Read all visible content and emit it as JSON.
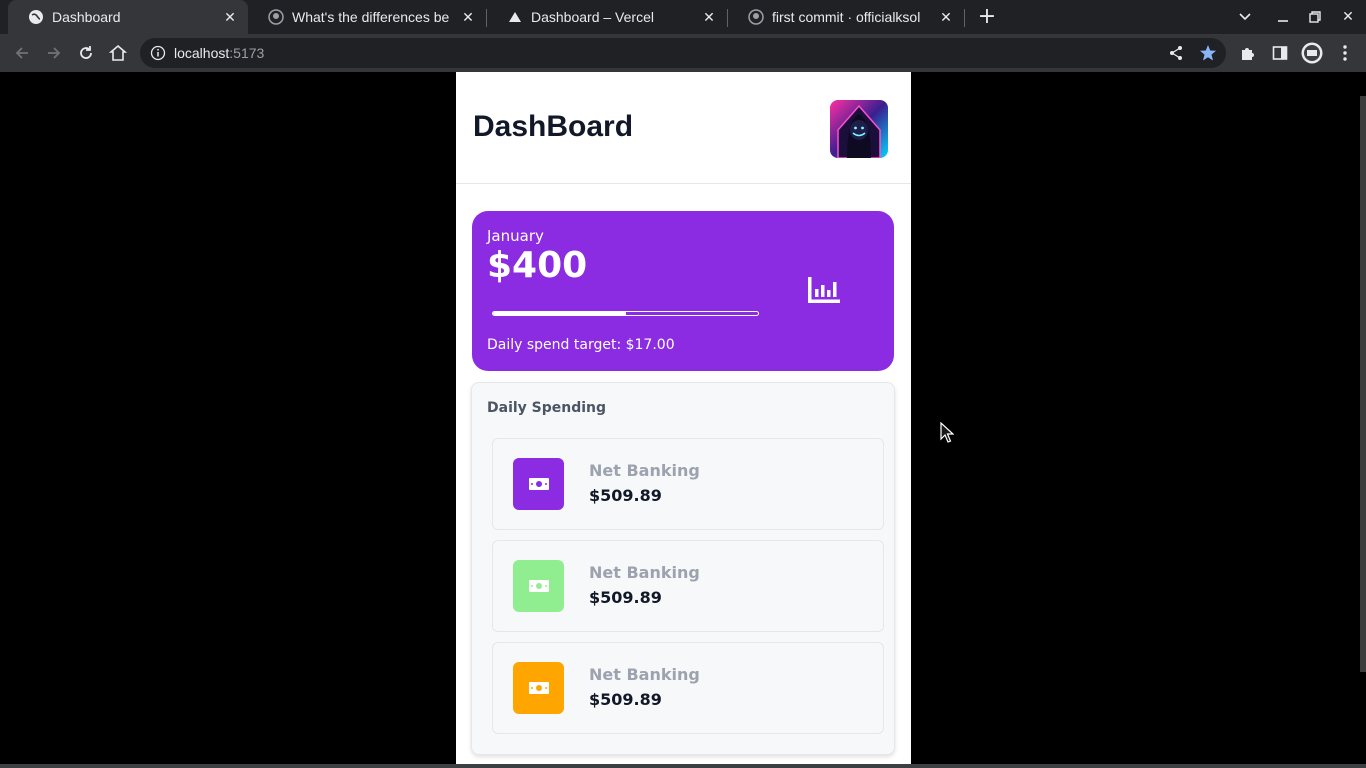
{
  "browser": {
    "tabs": [
      {
        "title": "Dashboard",
        "favicon": "globe-icon",
        "active": true
      },
      {
        "title": "What's the differences be",
        "favicon": "github-icon",
        "active": false
      },
      {
        "title": "Dashboard – Vercel",
        "favicon": "vercel-triangle-icon",
        "active": false
      },
      {
        "title": "first commit · officialksol",
        "favicon": "github-icon",
        "active": false
      }
    ],
    "url_host": "localhost",
    "url_port": ":5173"
  },
  "app": {
    "title": "DashBoard",
    "month_card": {
      "month": "January",
      "amount": "$400",
      "progress": 0.5,
      "daily_target": "Daily spend target: $17.00",
      "color": "#8b2be2"
    },
    "spending": {
      "title": "Daily Spending",
      "items": [
        {
          "name": "Net Banking",
          "amount": "$509.89",
          "color": "#8b2be2",
          "icon": "money-bill-icon"
        },
        {
          "name": "Net Banking",
          "amount": "$509.89",
          "color": "#90ee90",
          "icon": "money-bill-icon"
        },
        {
          "name": "Net Banking",
          "amount": "$509.89",
          "color": "#ffa500",
          "icon": "money-bill-icon"
        }
      ]
    }
  }
}
